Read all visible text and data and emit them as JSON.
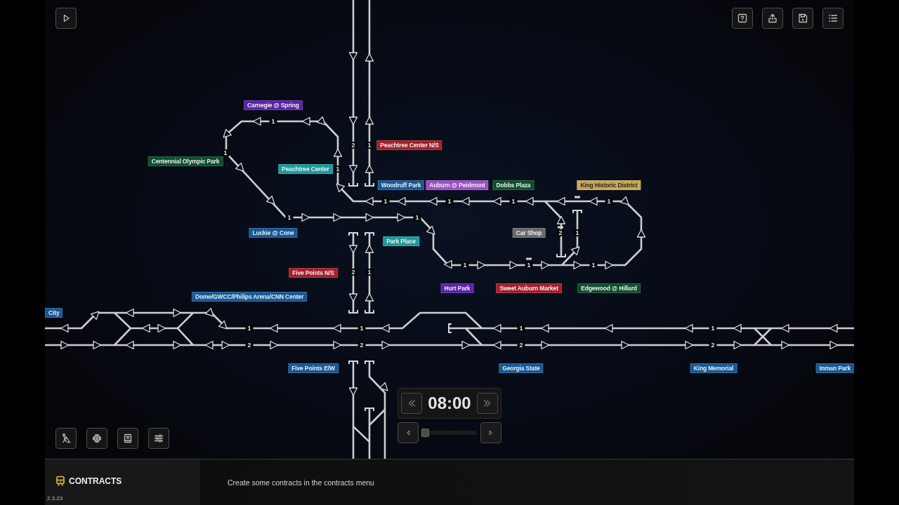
{
  "stations": [
    {
      "name": "Carnegie @ Spring",
      "color": "#5a23a6"
    },
    {
      "name": "Peachtree Center N/S",
      "color": "#a51f2b"
    },
    {
      "name": "Centennial Olympic Park",
      "color": "#0d4f2e"
    },
    {
      "name": "Peachtree Center",
      "color": "#1a9a9c"
    },
    {
      "name": "Woodruff Park",
      "color": "#155896"
    },
    {
      "name": "Auburn @ Peidmont",
      "color": "#9b4fc6"
    },
    {
      "name": "Dobbs Plaza",
      "color": "#0d4f2e"
    },
    {
      "name": "King Historic District",
      "color": "#c6a85a"
    },
    {
      "name": "Luckie @ Cone",
      "color": "#155896"
    },
    {
      "name": "Car Shop",
      "color": "#6a6a6a"
    },
    {
      "name": "Park Place",
      "color": "#1a9a9c"
    },
    {
      "name": "Five Points N/S",
      "color": "#a51f2b"
    },
    {
      "name": "Hurt Park",
      "color": "#5a23a6"
    },
    {
      "name": "Sweet Auburn Market",
      "color": "#a51f2b"
    },
    {
      "name": "Edgewood @ Hillard",
      "color": "#0d4f2e"
    },
    {
      "name": "Dome/GWCC/Philips Arena/CNN Center",
      "color": "#155896"
    },
    {
      "name": "City",
      "color": "#155896"
    },
    {
      "name": "Five Points E/W",
      "color": "#155896"
    },
    {
      "name": "Georgia State",
      "color": "#155896"
    },
    {
      "name": "King Memorial",
      "color": "#155896"
    },
    {
      "name": "Inman Park",
      "color": "#155896"
    }
  ],
  "track_numbers": [
    "1",
    "2",
    "1",
    "1",
    "1",
    "1",
    "1",
    "1",
    "1",
    "1",
    "1",
    "2",
    "1",
    "1",
    "1",
    "1",
    "2",
    "1",
    "1",
    "1",
    "1",
    "1",
    "2",
    "2",
    "2",
    "2"
  ],
  "clock": {
    "time": "08:00"
  },
  "speed_slider": {
    "level": 0
  },
  "contracts_panel": {
    "title": "CONTRACTS",
    "message": "Create some contracts in the contracts menu"
  },
  "version": "2.3.23"
}
